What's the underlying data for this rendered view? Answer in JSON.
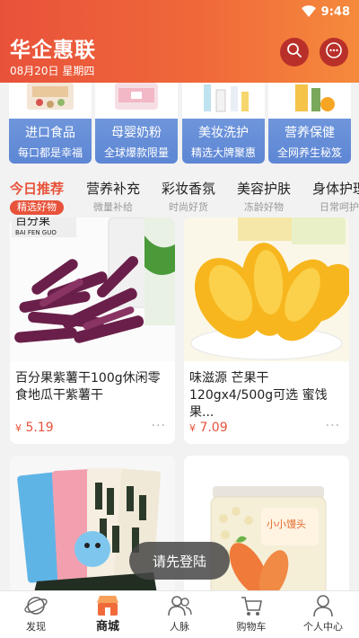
{
  "status": {
    "time": "9:48"
  },
  "header": {
    "title": "华企惠联",
    "date": "08月20日 星期四",
    "search_icon": "search-icon",
    "more_icon": "more-icon"
  },
  "categories": [
    {
      "title": "进口食品",
      "subtitle": "每口都是幸福"
    },
    {
      "title": "母婴奶粉",
      "subtitle": "全球爆款限量"
    },
    {
      "title": "美妆洗护",
      "subtitle": "精选大牌聚惠"
    },
    {
      "title": "营养保健",
      "subtitle": "全网养生秘笈"
    }
  ],
  "tabs": [
    {
      "title": "今日推荐",
      "subtitle": "精选好物"
    },
    {
      "title": "营养补充",
      "subtitle": "微量补给"
    },
    {
      "title": "彩妆香氛",
      "subtitle": "时尚好货"
    },
    {
      "title": "美容护肤",
      "subtitle": "冻龄好物"
    },
    {
      "title": "身体护理",
      "subtitle": "日常呵护"
    }
  ],
  "products": [
    {
      "name": "百分果紫薯干100g休闲零食地瓜干紫薯干",
      "currency": "¥",
      "price": "5.19",
      "brand_text": "百分果",
      "brand_pinyin": "BAI FEN GUO"
    },
    {
      "name": "味滋源 芒果干120gx4/500g可选 蜜饯果...",
      "currency": "¥",
      "price": "7.09"
    },
    {
      "name": "",
      "currency": "",
      "price": ""
    },
    {
      "name": "",
      "currency": "",
      "price": "",
      "jar_label": "小小馒头"
    }
  ],
  "toast": "请先登陆",
  "bottom_nav": [
    {
      "label": "发现",
      "icon": "planet-icon"
    },
    {
      "label": "商城",
      "icon": "shop-icon"
    },
    {
      "label": "人脉",
      "icon": "people-icon"
    },
    {
      "label": "购物车",
      "icon": "cart-icon"
    },
    {
      "label": "个人中心",
      "icon": "person-icon"
    }
  ],
  "colors": {
    "accent": "#e8523a",
    "category_blue": "#6f96db"
  }
}
